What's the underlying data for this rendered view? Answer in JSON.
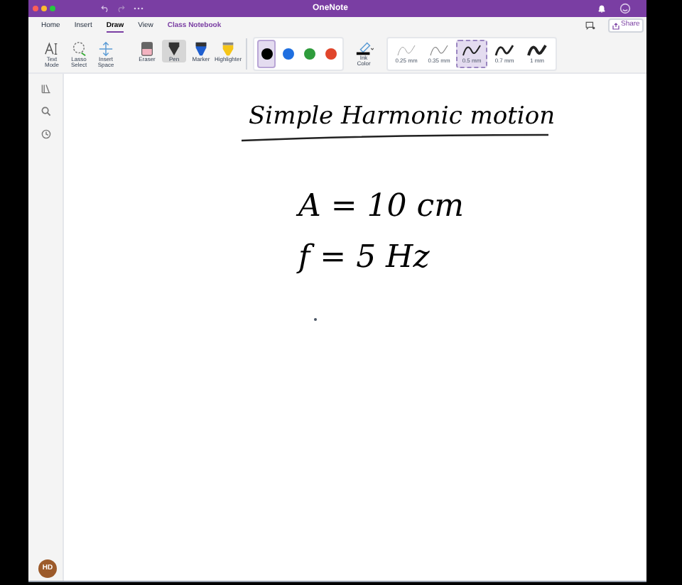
{
  "window": {
    "title": "OneNote"
  },
  "tabs": [
    {
      "label": "Home",
      "selected": false
    },
    {
      "label": "Insert",
      "selected": false
    },
    {
      "label": "Draw",
      "selected": true
    },
    {
      "label": "View",
      "selected": false
    },
    {
      "label": "Class Notebook",
      "selected": false
    }
  ],
  "share_button": {
    "label": "Share"
  },
  "tools": [
    {
      "kind": "text",
      "label": "Text Mode",
      "selected": false
    },
    {
      "kind": "lasso",
      "label": "Lasso Select",
      "selected": false
    },
    {
      "kind": "space",
      "label": "Insert Space",
      "selected": false
    },
    {
      "kind": "eraser",
      "label": "Eraser",
      "selected": false
    },
    {
      "kind": "pen",
      "label": "Pen",
      "selected": true
    },
    {
      "kind": "marker",
      "label": "Marker",
      "selected": false
    },
    {
      "kind": "highlighter",
      "label": "Highlighter",
      "selected": false
    }
  ],
  "colors": [
    {
      "color": "#000000",
      "selected": true
    },
    {
      "color": "#1f6fe0",
      "selected": false
    },
    {
      "color": "#2e9c3c",
      "selected": false
    },
    {
      "color": "#e0452b",
      "selected": false
    }
  ],
  "ink_color": {
    "label": "Ink Color"
  },
  "thicknesses": [
    {
      "label": "0.25 mm",
      "selected": false
    },
    {
      "label": "0.35 mm",
      "selected": false
    },
    {
      "label": "0.5 mm",
      "selected": true
    },
    {
      "label": "0.7 mm",
      "selected": false
    },
    {
      "label": "1 mm",
      "selected": false
    }
  ],
  "avatar": "HD",
  "page": {
    "title": "Simple Harmonic motion",
    "lines": [
      "A = 10 cm",
      "f = 5 Hz"
    ]
  }
}
